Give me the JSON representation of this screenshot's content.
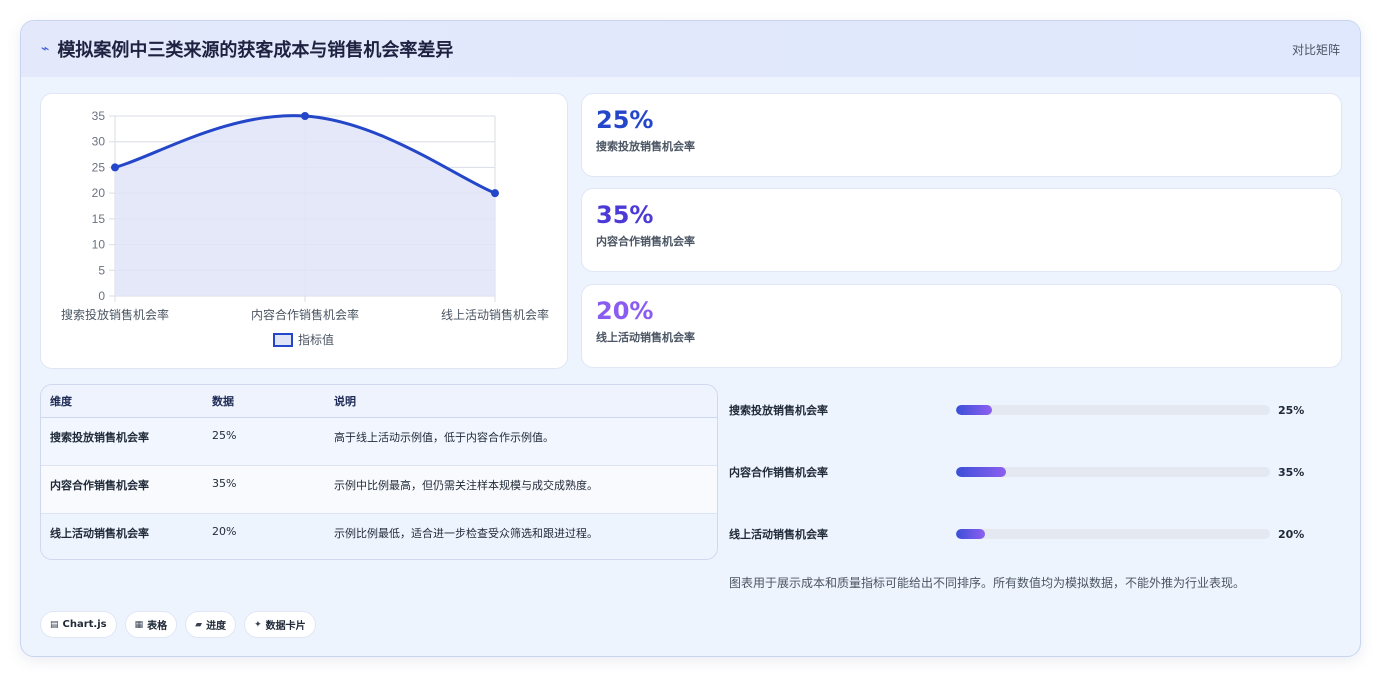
{
  "header": {
    "title_icon": "⌁",
    "title": "模拟案例中三类来源的获客成本与销售机会率差异",
    "view_mode": "对比矩阵"
  },
  "chart_data": {
    "type": "line",
    "categories": [
      "搜索投放销售机会率",
      "内容合作销售机会率",
      "线上活动销售机会率"
    ],
    "series": [
      {
        "name": "指标值",
        "values": [
          25,
          35,
          20
        ]
      }
    ],
    "ylim": [
      0,
      35
    ],
    "yticks": [
      0,
      5,
      10,
      15,
      20,
      25,
      30,
      35
    ],
    "grid": true,
    "legend": "bottom",
    "fill": true,
    "curve": "smooth",
    "colors": {
      "line": "#2446c9",
      "fill": "#dfe4f7",
      "grid": "#d9dde6",
      "tick": "#6b7280"
    }
  },
  "stats": [
    {
      "value": "25%",
      "label": "搜索投放销售机会率",
      "color": "#2446c9"
    },
    {
      "value": "35%",
      "label": "内容合作销售机会率",
      "color": "#4b3ad6"
    },
    {
      "value": "20%",
      "label": "线上活动销售机会率",
      "color": "#8a5cf0"
    }
  ],
  "table": {
    "headers": [
      "维度",
      "数据",
      "说明"
    ],
    "rows": [
      [
        "搜索投放销售机会率",
        "25%",
        "高于线上活动示例值，低于内容合作示例值。"
      ],
      [
        "内容合作销售机会率",
        "35%",
        "示例中比例最高，但仍需关注样本规模与成交成熟度。"
      ],
      [
        "线上活动销售机会率",
        "20%",
        "示例比例最低，适合进一步检查受众筛选和跟进过程。"
      ]
    ]
  },
  "progress": [
    {
      "label": "搜索投放销售机会率",
      "value_text": "25%",
      "fraction": 0.115
    },
    {
      "label": "内容合作销售机会率",
      "value_text": "35%",
      "fraction": 0.16
    },
    {
      "label": "线上活动销售机会率",
      "value_text": "20%",
      "fraction": 0.092
    }
  ],
  "note": "图表用于展示成本和质量指标可能给出不同排序。所有数值均为模拟数据，不能外推为行业表现。",
  "tags": [
    {
      "icon": "▤",
      "label": "Chart.js"
    },
    {
      "icon": "▦",
      "label": "表格"
    },
    {
      "icon": "▰",
      "label": "进度"
    },
    {
      "icon": "✦",
      "label": "数据卡片"
    }
  ]
}
